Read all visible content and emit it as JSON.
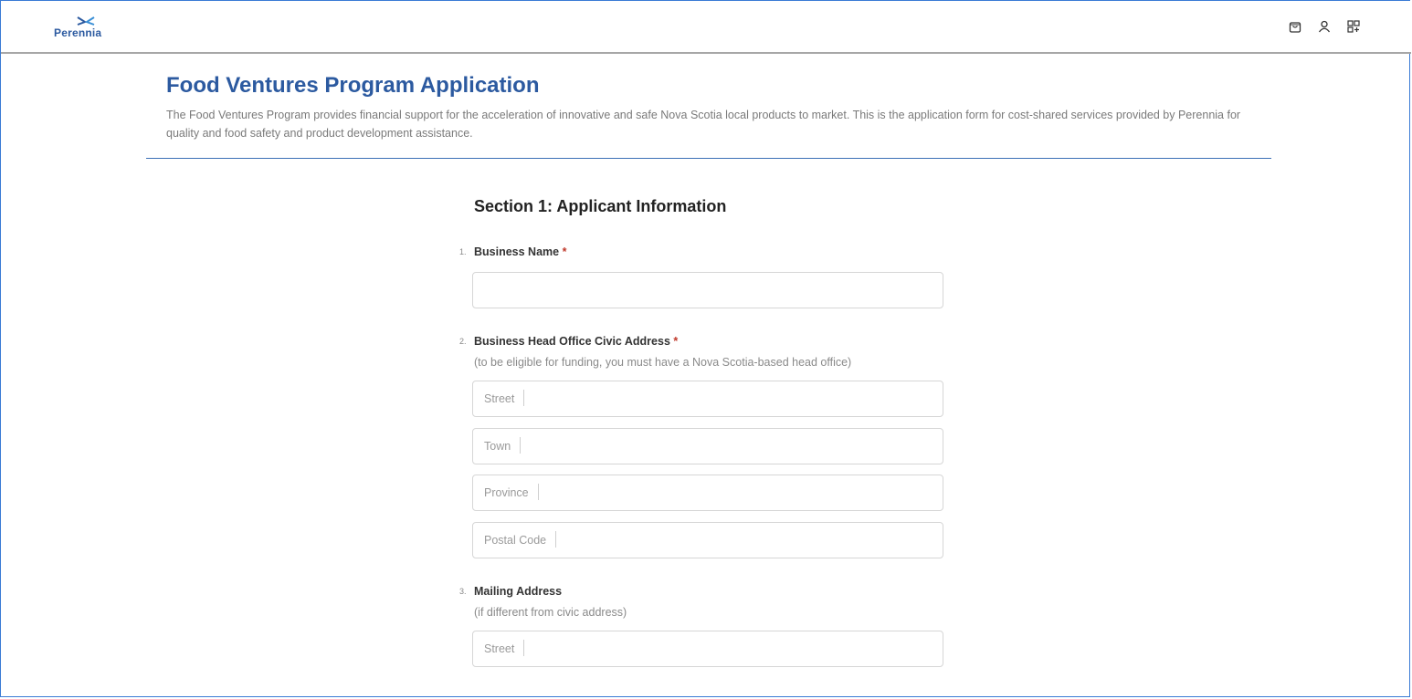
{
  "brand": {
    "name": "Perennia"
  },
  "top_icons": [
    "shopping-bag-icon",
    "user-icon",
    "apps-grid-icon"
  ],
  "page": {
    "title": "Food Ventures Program Application",
    "description": "The Food Ventures Program provides financial support for the acceleration of innovative and safe Nova Scotia local products to market. This is the application form for cost-shared services provided by Perennia for quality and food safety and product development assistance."
  },
  "section1": {
    "title": "Section 1: Applicant Information",
    "q1": {
      "number": "1.",
      "label": "Business Name",
      "required_mark": "*",
      "value": ""
    },
    "q2": {
      "number": "2.",
      "label": "Business Head Office Civic Address",
      "required_mark": "*",
      "hint": "(to be eligible for funding, you must have a Nova Scotia-based head office)",
      "street_placeholder": "Street",
      "town_placeholder": "Town",
      "province_placeholder": "Province",
      "postal_placeholder": "Postal Code"
    },
    "q3": {
      "number": "3.",
      "label": "Mailing Address",
      "hint": "(if different from civic address)",
      "street_placeholder": "Street"
    }
  },
  "colors": {
    "accent": "#2c5aa0",
    "required": "#c0392b",
    "rule": "#3b6fb6"
  }
}
